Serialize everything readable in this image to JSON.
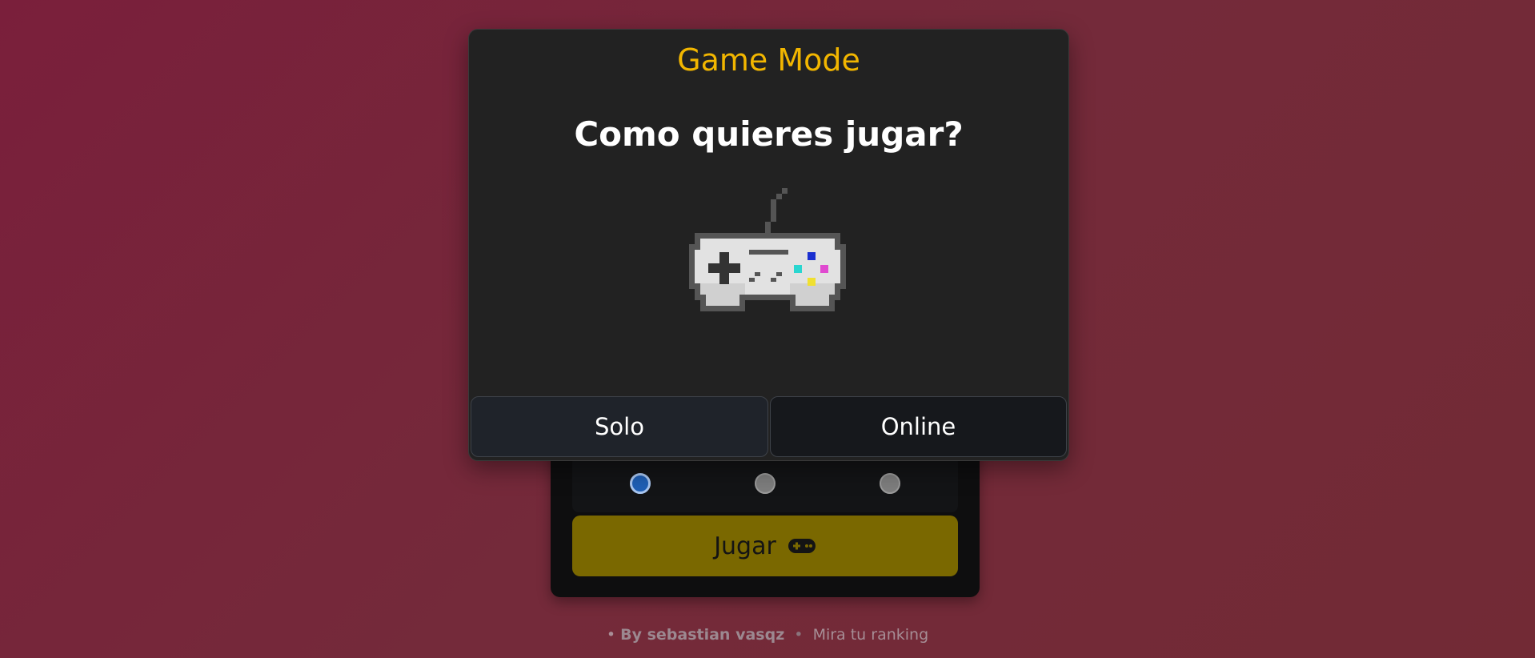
{
  "modal": {
    "title": "Game Mode",
    "question": "Como quieres jugar?",
    "options": [
      {
        "label": "Solo"
      },
      {
        "label": "Online"
      }
    ]
  },
  "background_card": {
    "selector_dots": [
      {
        "selected": true
      },
      {
        "selected": false
      },
      {
        "selected": false
      }
    ],
    "play_button": {
      "label": "Jugar",
      "icon": "gamepad-icon"
    }
  },
  "footer": {
    "bullet": "•",
    "author": "By sebastian vasqz",
    "separator": "•",
    "ranking_link": "Mira tu ranking"
  },
  "colors": {
    "title_accent": "#f2b600",
    "play_button": "#7a6800",
    "selected_dot": "#1f5fb5",
    "modal_bg": "#222222"
  }
}
